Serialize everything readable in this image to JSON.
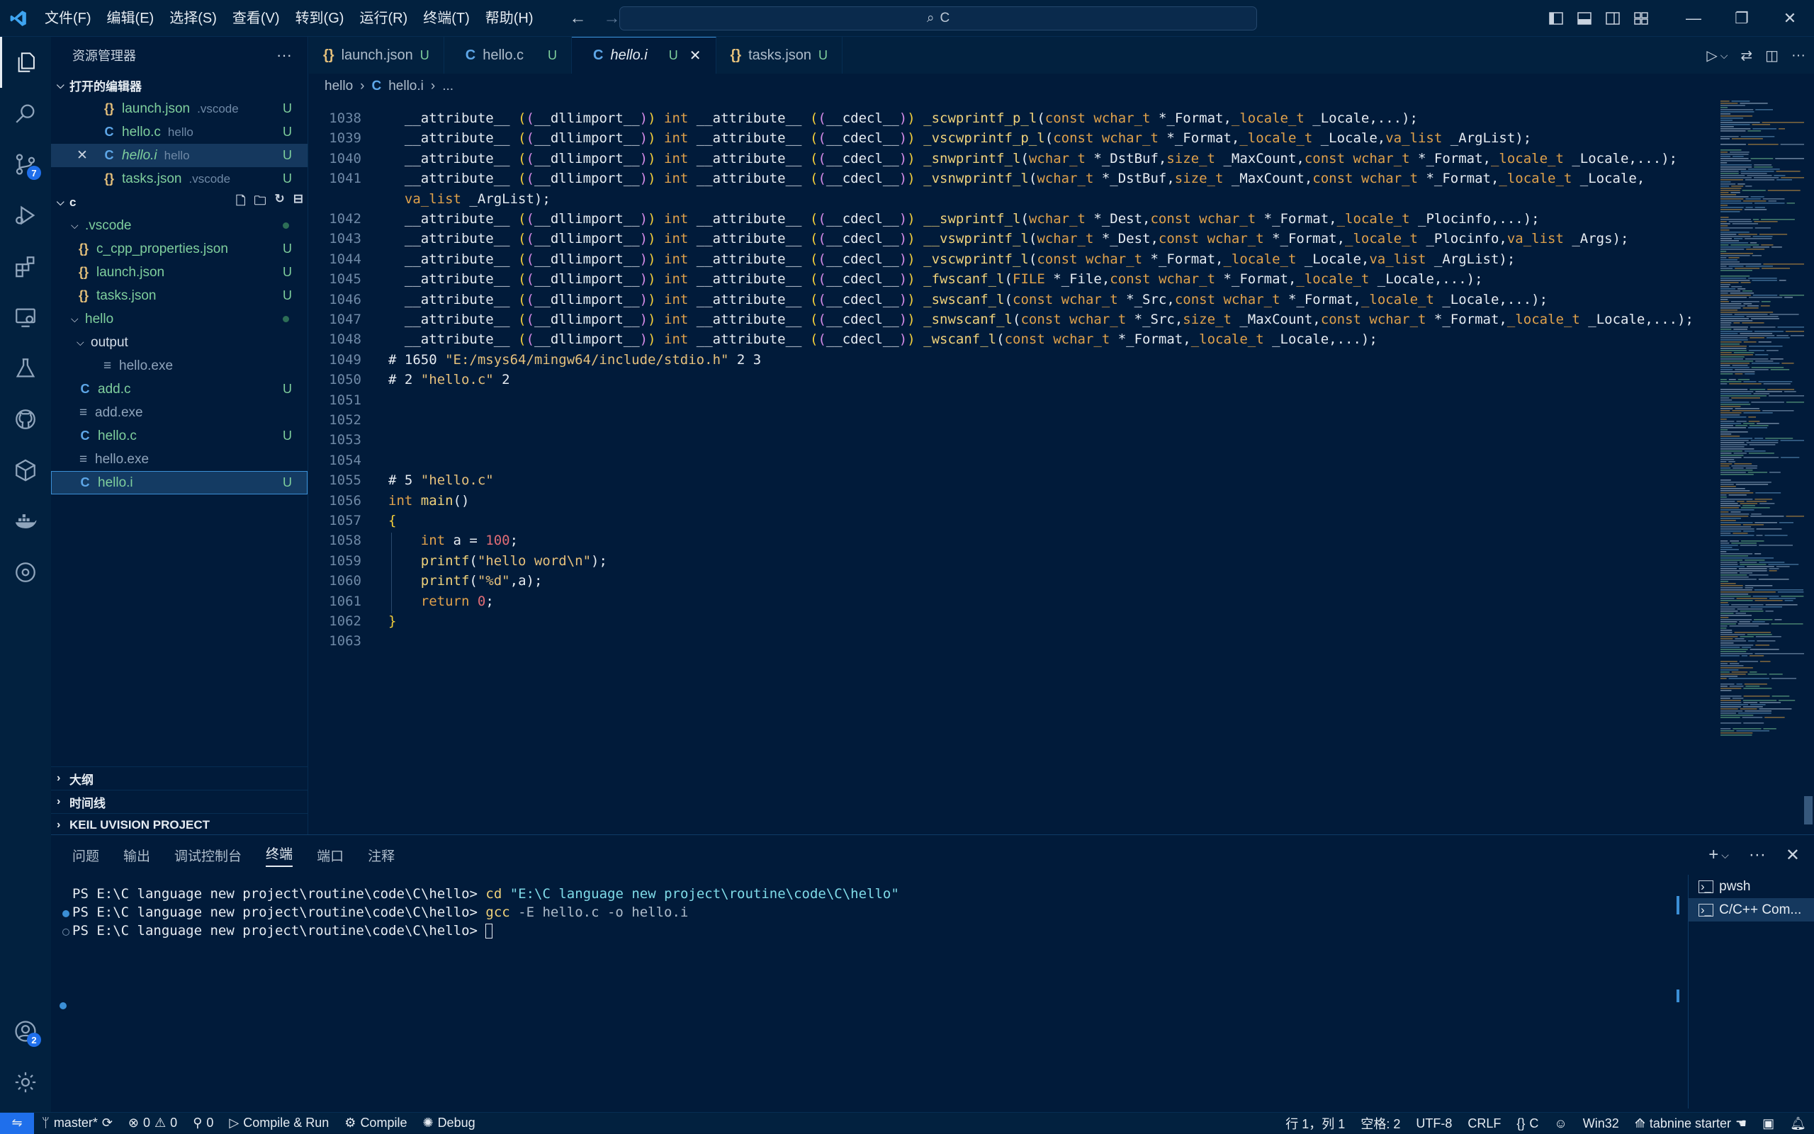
{
  "menu": [
    "文件(F)",
    "编辑(E)",
    "选择(S)",
    "查看(V)",
    "转到(G)",
    "运行(R)",
    "终端(T)",
    "帮助(H)"
  ],
  "command_center": {
    "text": "C",
    "icon": "search-icon"
  },
  "explorer": {
    "title": "资源管理器",
    "open_editors_label": "打开的编辑器",
    "open_editors": [
      {
        "name": "launch.json",
        "hint": ".vscode",
        "status": "U",
        "type": "json"
      },
      {
        "name": "hello.c",
        "hint": "hello",
        "status": "U",
        "type": "c"
      },
      {
        "name": "hello.i",
        "hint": "hello",
        "status": "U",
        "type": "c"
      },
      {
        "name": "tasks.json",
        "hint": ".vscode",
        "status": "U",
        "type": "json"
      }
    ],
    "folder_label": "C",
    "tree": [
      {
        "name": ".vscode",
        "kind": "folder",
        "dot": true
      },
      {
        "name": "c_cpp_properties.json",
        "kind": "json",
        "status": "U"
      },
      {
        "name": "launch.json",
        "kind": "json",
        "status": "U"
      },
      {
        "name": "tasks.json",
        "kind": "json",
        "status": "U"
      },
      {
        "name": "hello",
        "kind": "folder",
        "dot": true
      },
      {
        "name": "output",
        "kind": "folder"
      },
      {
        "name": "hello.exe",
        "kind": "exe"
      },
      {
        "name": "add.c",
        "kind": "c",
        "status": "U"
      },
      {
        "name": "add.exe",
        "kind": "exe"
      },
      {
        "name": "hello.c",
        "kind": "c",
        "status": "U"
      },
      {
        "name": "hello.exe",
        "kind": "exe"
      },
      {
        "name": "hello.i",
        "kind": "c",
        "status": "U"
      }
    ],
    "bottom_sections": [
      "大纲",
      "时间线",
      "KEIL UVISION PROJECT"
    ]
  },
  "tabs": [
    {
      "label": "launch.json",
      "status": "U",
      "type": "json"
    },
    {
      "label": "hello.c",
      "status": "U",
      "type": "c"
    },
    {
      "label": "hello.i",
      "status": "U",
      "type": "c",
      "active": true
    },
    {
      "label": "tasks.json",
      "status": "U",
      "type": "json"
    }
  ],
  "breadcrumb": [
    "hello",
    "hello.i",
    "..."
  ],
  "code_lines": [
    {
      "n": "1038",
      "prefix": "  __attribute__ ((__dllimport__)) int __attribute__ ((__cdecl__)) ",
      "fn": "_scwprintf_p_l",
      "rest": "(const wchar_t *_Format,_locale_t _Locale,...);"
    },
    {
      "n": "1039",
      "prefix": "  __attribute__ ((__dllimport__)) int __attribute__ ((__cdecl__)) ",
      "fn": "_vscwprintf_p_l",
      "rest": "(const wchar_t *_Format,_locale_t _Locale,va_list _ArgList);"
    },
    {
      "n": "1040",
      "prefix": "  __attribute__ ((__dllimport__)) int __attribute__ ((__cdecl__)) ",
      "fn": "_snwprintf_l",
      "rest": "(wchar_t *_DstBuf,size_t _MaxCount,const wchar_t *_Format,_locale_t _Locale,...);"
    },
    {
      "n": "1041",
      "prefix": "  __attribute__ ((__dllimport__)) int __attribute__ ((__cdecl__)) ",
      "fn": "_vsnwprintf_l",
      "rest": "(wchar_t *_DstBuf,size_t _MaxCount,const wchar_t *_Format,_locale_t _Locale,"
    },
    {
      "n": "",
      "prefix": "  va_list _ArgList);",
      "fn": "",
      "rest": ""
    },
    {
      "n": "1042",
      "prefix": "  __attribute__ ((__dllimport__)) int __attribute__ ((__cdecl__)) ",
      "fn": "__swprintf_l",
      "rest": "(wchar_t *_Dest,const wchar_t *_Format,_locale_t _Plocinfo,...);"
    },
    {
      "n": "1043",
      "prefix": "  __attribute__ ((__dllimport__)) int __attribute__ ((__cdecl__)) ",
      "fn": "__vswprintf_l",
      "rest": "(wchar_t *_Dest,const wchar_t *_Format,_locale_t _Plocinfo,va_list _Args);"
    },
    {
      "n": "1044",
      "prefix": "  __attribute__ ((__dllimport__)) int __attribute__ ((__cdecl__)) ",
      "fn": "_vscwprintf_l",
      "rest": "(const wchar_t *_Format,_locale_t _Locale,va_list _ArgList);"
    },
    {
      "n": "1045",
      "prefix": "  __attribute__ ((__dllimport__)) int __attribute__ ((__cdecl__)) ",
      "fn": "_fwscanf_l",
      "rest": "(FILE *_File,const wchar_t *_Format,_locale_t _Locale,...);"
    },
    {
      "n": "1046",
      "prefix": "  __attribute__ ((__dllimport__)) int __attribute__ ((__cdecl__)) ",
      "fn": "_swscanf_l",
      "rest": "(const wchar_t *_Src,const wchar_t *_Format,_locale_t _Locale,...);"
    },
    {
      "n": "1047",
      "prefix": "  __attribute__ ((__dllimport__)) int __attribute__ ((__cdecl__)) ",
      "fn": "_snwscanf_l",
      "rest": "(const wchar_t *_Src,size_t _MaxCount,const wchar_t *_Format,_locale_t _Locale,...);"
    },
    {
      "n": "1048",
      "prefix": "  __attribute__ ((__dllimport__)) int __attribute__ ((__cdecl__)) ",
      "fn": "_wscanf_l",
      "rest": "(const wchar_t *_Format,_locale_t _Locale,...);"
    },
    {
      "n": "1049",
      "prefix": "# 1650 \"E:/msys64/mingw64/include/stdio.h\" 2 3",
      "fn": "",
      "rest": ""
    },
    {
      "n": "1050",
      "prefix": "# 2 \"hello.c\" 2",
      "fn": "",
      "rest": ""
    },
    {
      "n": "1051",
      "prefix": "",
      "fn": "",
      "rest": ""
    },
    {
      "n": "1052",
      "prefix": "",
      "fn": "",
      "rest": ""
    },
    {
      "n": "1053",
      "prefix": "",
      "fn": "",
      "rest": ""
    },
    {
      "n": "1054",
      "prefix": "",
      "fn": "",
      "rest": ""
    },
    {
      "n": "1055",
      "prefix": "# 5 \"hello.c\"",
      "fn": "",
      "rest": ""
    },
    {
      "n": "1056",
      "prefix": "int main()",
      "fn": "",
      "rest": ""
    },
    {
      "n": "1057",
      "prefix": "{",
      "fn": "",
      "rest": ""
    },
    {
      "n": "1058",
      "prefix": "    int a = 100;",
      "fn": "",
      "rest": ""
    },
    {
      "n": "1059",
      "prefix": "    printf(\"hello word\\n\");",
      "fn": "",
      "rest": ""
    },
    {
      "n": "1060",
      "prefix": "    printf(\"%d\",a);",
      "fn": "",
      "rest": ""
    },
    {
      "n": "1061",
      "prefix": "    return 0;",
      "fn": "",
      "rest": ""
    },
    {
      "n": "1062",
      "prefix": "}",
      "fn": "",
      "rest": ""
    },
    {
      "n": "1063",
      "prefix": "",
      "fn": "",
      "rest": ""
    }
  ],
  "panel": {
    "tabs": [
      "问题",
      "输出",
      "调试控制台",
      "终端",
      "端口",
      "注释"
    ],
    "active_tab": "终端",
    "terminal_lines": [
      {
        "prompt": "PS E:\\C language new project\\routine\\code\\C\\hello> ",
        "cmd": "cd",
        "args": "",
        "quoted": "\"E:\\C language new project\\routine\\code\\C\\hello\""
      },
      {
        "prompt": "PS E:\\C language new project\\routine\\code\\C\\hello> ",
        "cmd": "gcc",
        "args": " -E hello.c -o hello.i",
        "quoted": ""
      },
      {
        "prompt": "PS E:\\C language new project\\routine\\code\\C\\hello> ",
        "cmd": "",
        "args": "",
        "quoted": ""
      }
    ],
    "terminals": [
      "pwsh",
      "C/C++ Com..."
    ]
  },
  "status": {
    "branch": "master*",
    "errors": "0",
    "warnings": "0",
    "ports": "0",
    "compile_run": "Compile & Run",
    "compile": "Compile",
    "debug": "Debug",
    "cursor_pos": "行 1，列 1",
    "spaces": "空格: 2",
    "encoding": "UTF-8",
    "eol": "CRLF",
    "language": "C",
    "platform": "Win32",
    "tabnine": "tabnine starter"
  },
  "badges": {
    "scm": "7",
    "accounts": "2"
  },
  "colors": {
    "accent": "#1f6feb",
    "bg": "#011b3a",
    "chrome": "#02213f"
  }
}
